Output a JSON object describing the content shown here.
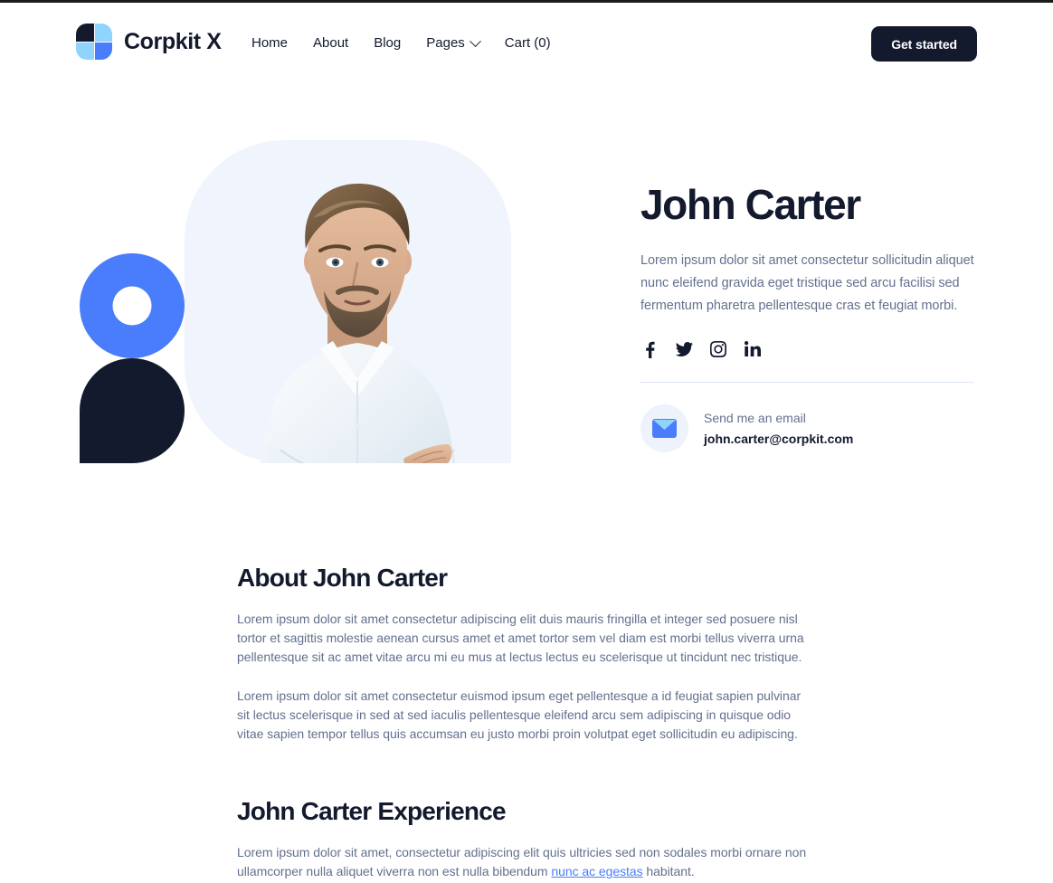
{
  "colors": {
    "navy": "#131A2E",
    "blue": "#4A7DFC",
    "light_blue": "#8FD4FC",
    "panel": "#F0F4FC",
    "body_text": "#63708D",
    "divider": "#DDE6F4"
  },
  "navbar": {
    "brand": "Corpkit X",
    "logo_icon": "four-square-logo-icon",
    "links": [
      {
        "label": "Home",
        "icon": null
      },
      {
        "label": "About",
        "icon": null
      },
      {
        "label": "Blog",
        "icon": null
      },
      {
        "label": "Pages",
        "icon": "chevron-down-icon"
      },
      {
        "label": "Cart (0)",
        "icon": null
      }
    ],
    "cta_label": "Get started"
  },
  "hero": {
    "portrait_alt": "Portrait of John Carter with arms crossed in a white shirt",
    "title": "John Carter",
    "description": "Lorem ipsum dolor sit amet consectetur sollicitudin aliquet nunc eleifend gravida eget tristique sed arcu facilisi sed fermentum pharetra pellentesque cras et feugiat morbi.",
    "socials": [
      {
        "name": "facebook-icon",
        "label": "Facebook"
      },
      {
        "name": "twitter-icon",
        "label": "Twitter"
      },
      {
        "name": "instagram-icon",
        "label": "Instagram"
      },
      {
        "name": "linkedin-icon",
        "label": "LinkedIn"
      }
    ],
    "email_icon": "envelope-icon",
    "email_label": "Send me an email",
    "email_address": "john.carter@corpkit.com"
  },
  "about": {
    "heading": "About John Carter",
    "paragraph_1": "Lorem ipsum dolor sit amet consectetur adipiscing elit duis mauris fringilla et integer sed posuere nisl tortor et sagittis molestie aenean cursus amet et amet tortor sem vel diam est morbi tellus viverra urna pellentesque sit ac amet vitae arcu mi eu mus at lectus lectus eu scelerisque ut tincidunt nec tristique.",
    "paragraph_2": "Lorem ipsum dolor sit amet consectetur euismod ipsum eget pellentesque a id feugiat sapien pulvinar sit lectus scelerisque in sed at sed iaculis pellentesque eleifend arcu sem adipiscing in quisque odio vitae sapien tempor tellus quis accumsan eu justo morbi proin volutpat eget sollicitudin eu adipiscing."
  },
  "experience": {
    "heading": "John Carter Experience",
    "paragraph_before_link": "Lorem ipsum dolor sit amet, consectetur adipiscing elit quis ultricies sed non sodales morbi ornare non ullamcorper nulla aliquet viverra non est nulla bibendum ",
    "link_text": "nunc ac egestas",
    "paragraph_after_link": " habitant."
  }
}
